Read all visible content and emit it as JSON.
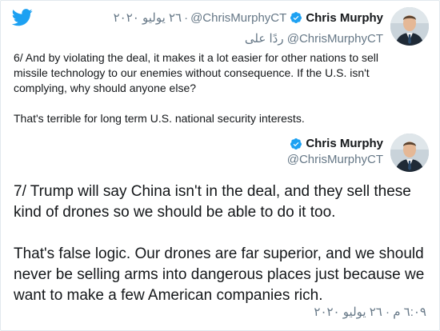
{
  "colors": {
    "twitter_blue": "#1da1f2",
    "text": "#14171a",
    "muted": "#657786",
    "border": "#e1e8ed"
  },
  "icons": {
    "logo": "twitter-bird-icon",
    "verified": "verified-badge-icon"
  },
  "tweet1": {
    "name": "Chris Murphy",
    "handle": "@ChrisMurphyCT",
    "date": "٢٦ يوليو ٢٠٢٠",
    "reply_prefix": "ردًا على",
    "reply_handle": "@ChrisMurphyCT",
    "paragraphs": [
      "6/ And by violating the deal, it makes it a lot easier for other nations to sell missile technology to our enemies without consequence. If the U.S. isn't complying, why should anyone else?",
      "That's terrible for long term U.S. national security interests."
    ]
  },
  "tweet2": {
    "name": "Chris Murphy",
    "handle": "@ChrisMurphyCT",
    "paragraphs": [
      "7/ Trump will say China isn't in the deal, and they sell these kind of drones so we should be able to do it too.",
      "That's false logic. Our drones are far superior, and we should never be selling arms into dangerous places just because we want to make a few American companies rich."
    ],
    "timestamp": "٦:٠٩ م · ٢٦ يوليو ٢٠٢٠"
  }
}
